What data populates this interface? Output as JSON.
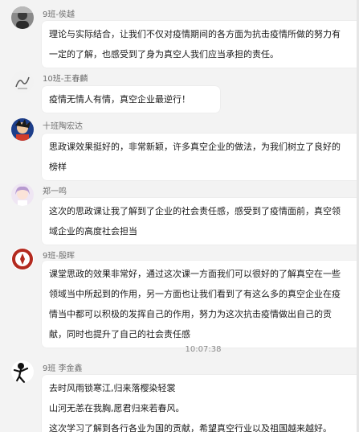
{
  "messages": [
    {
      "sender": "9班-侯越",
      "avatar": "photo-avatar-dark",
      "lines": [
        "理论与实际结合，让我们不仅对疫情期间的各方面为抗击疫情所做的努力有",
        "一定的了解，也感受到了身为真空人我们应当承担的责任。"
      ]
    },
    {
      "sender": "10班-王春麟",
      "avatar": "pen-sketch-avatar",
      "lines": [
        "疫情无情人有情，真空企业最逆行！"
      ]
    },
    {
      "sender": "十班陶宏达",
      "avatar": "anime-character-avatar",
      "lines": [
        "思政课效果挺好的，非常新颖，许多真空企业的做法，为我们树立了良好的",
        "榜样"
      ]
    },
    {
      "sender": "郑一鸣",
      "avatar": "anime-girl-avatar",
      "lines": [
        "这次的思政课让我了解到了企业的社会责任感，感受到了疫情面前，真空领",
        "域企业的高度社会担当"
      ]
    },
    {
      "sender": "9班-殷晖",
      "avatar": "emblem-avatar",
      "lines": [
        "课堂思政的效果非常好，通过这次课一方面我们可以很好的了解真空在一些",
        "领域当中所起到的作用，另一方面也让我们看到了有这么多的真空企业在疫",
        "情当中都可以积极的发挥自己的作用，努力为这次抗击疫情做出自己的贡",
        "献，同时也提升了自己的社会责任感"
      ]
    },
    {
      "sender": "9班 李金鑫",
      "avatar": "ink-figure-avatar",
      "lines": [
        "去时风雨锁寒江,归来落樱染轻裳",
        "山河无恙在我胸,愿君归来若春风。",
        "这次学习了解到各行各业为国的贡献，希望真空行业以及祖国越来越好。"
      ]
    }
  ],
  "timestamp": "10:07:38"
}
